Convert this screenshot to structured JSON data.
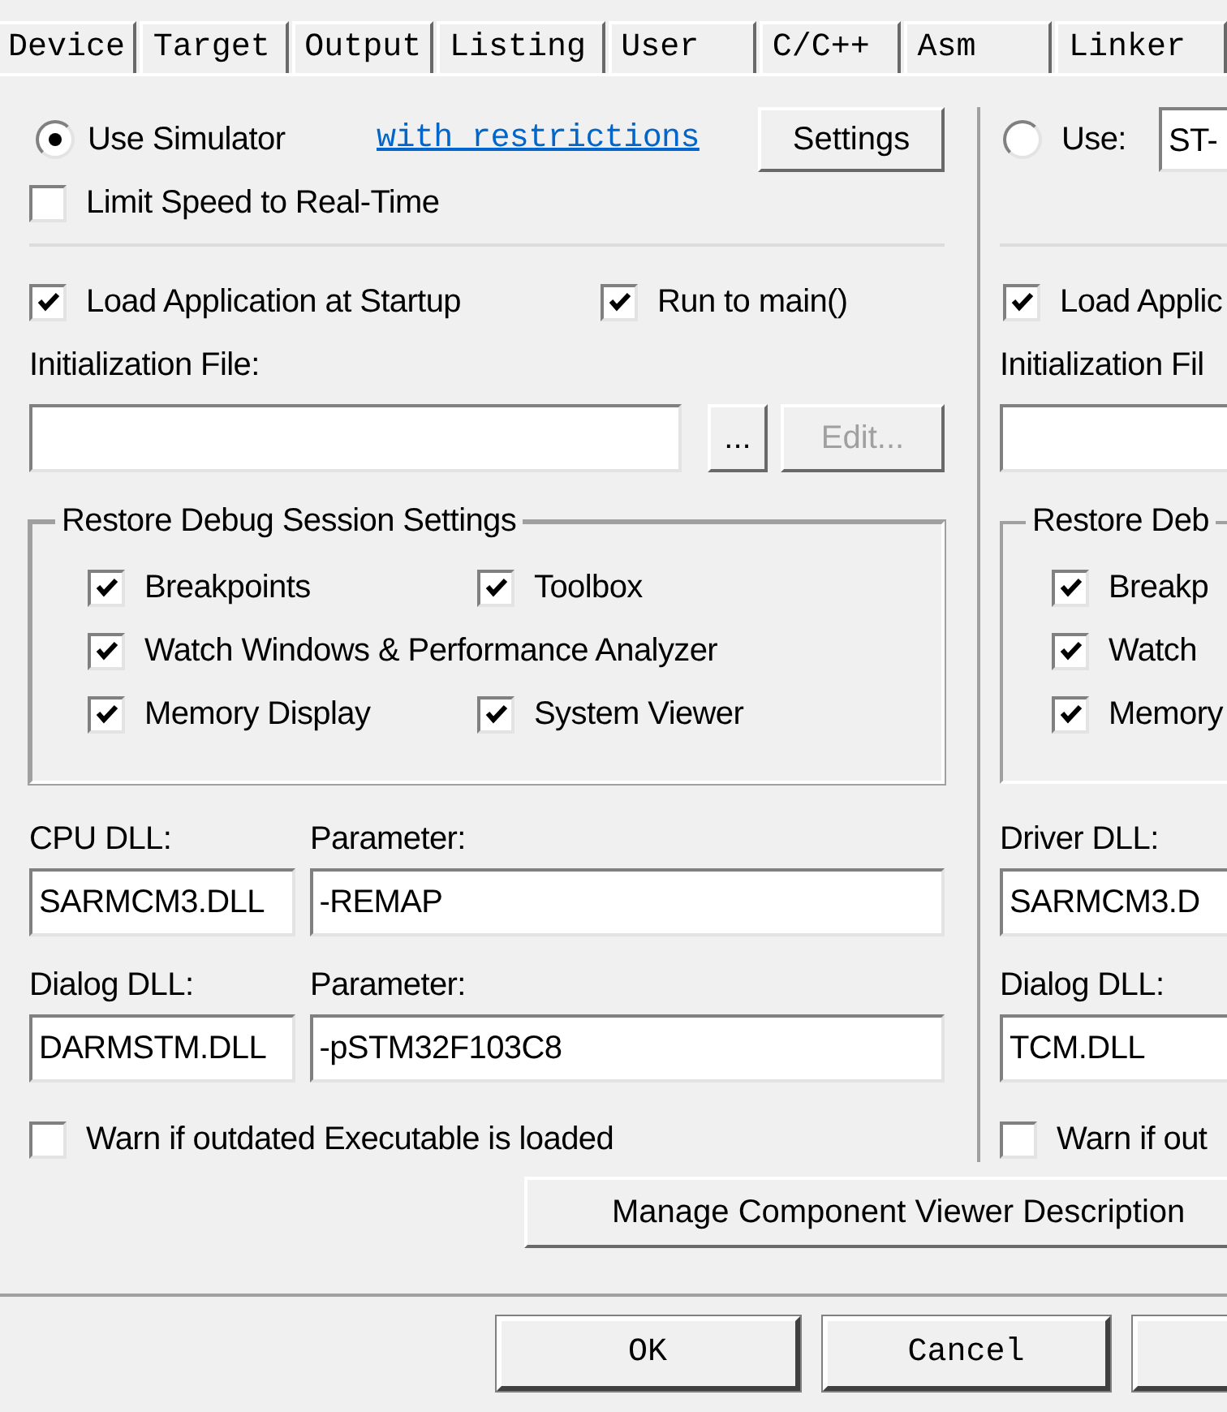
{
  "tabs": [
    {
      "label": "Device",
      "selected": false
    },
    {
      "label": "Target",
      "selected": false
    },
    {
      "label": "Output",
      "selected": false
    },
    {
      "label": "Listing",
      "selected": false
    },
    {
      "label": "User",
      "selected": false
    },
    {
      "label": "C/C++",
      "selected": false
    },
    {
      "label": "Asm",
      "selected": false
    },
    {
      "label": "Linker",
      "selected": false
    }
  ],
  "left": {
    "mode": {
      "label": "Use Simulator",
      "selected": true
    },
    "link": "with restrictions",
    "settings_button": "Settings",
    "limit_speed": {
      "label": "Limit Speed to Real-Time",
      "checked": false
    },
    "load_app": {
      "label": "Load Application at Startup",
      "checked": true
    },
    "run_to_main": {
      "label": "Run to main()",
      "checked": true
    },
    "init_file_label": "Initialization File:",
    "browse_button": "...",
    "edit_button": {
      "label": "Edit...",
      "disabled": true
    },
    "restore": {
      "title": "Restore Debug Session Settings",
      "options": [
        {
          "label": "Breakpoints",
          "checked": true
        },
        {
          "label": "Toolbox",
          "checked": true
        },
        {
          "label": "Watch Windows & Performance Analyzer",
          "checked": true
        },
        {
          "label": "Memory Display",
          "checked": true
        },
        {
          "label": "System Viewer",
          "checked": true
        }
      ]
    },
    "dlls": [
      {
        "label": "CPU DLL:",
        "value": "SARMCM3.DLL",
        "param_label": "Parameter:",
        "param_value": "-REMAP"
      },
      {
        "label": "Dialog DLL:",
        "value": "DARMSTM.DLL",
        "param_label": "Parameter:",
        "param_value": "-pSTM32F103C8"
      }
    ],
    "warn": {
      "label": "Warn if outdated Executable is loaded",
      "checked": false
    }
  },
  "right": {
    "mode": {
      "label": "Use:",
      "selected": false
    },
    "driver": "ST-",
    "load_app": {
      "label": "Load Applic",
      "checked": true
    },
    "init_file_label": "Initialization Fil",
    "restore": {
      "title": "Restore Deb",
      "options": [
        {
          "label": "Breakp",
          "checked": true
        },
        {
          "label": "Watch",
          "checked": true
        },
        {
          "label": "Memory",
          "checked": true
        }
      ]
    },
    "dlls": [
      {
        "label": "Driver DLL:",
        "value": "SARMCM3.D"
      },
      {
        "label": "Dialog DLL:",
        "value": "TCM.DLL"
      }
    ],
    "warn": {
      "label": "Warn if out",
      "checked": false
    }
  },
  "manage_button": "Manage Component Viewer Description",
  "footer_buttons": [
    "OK",
    "Cancel"
  ]
}
